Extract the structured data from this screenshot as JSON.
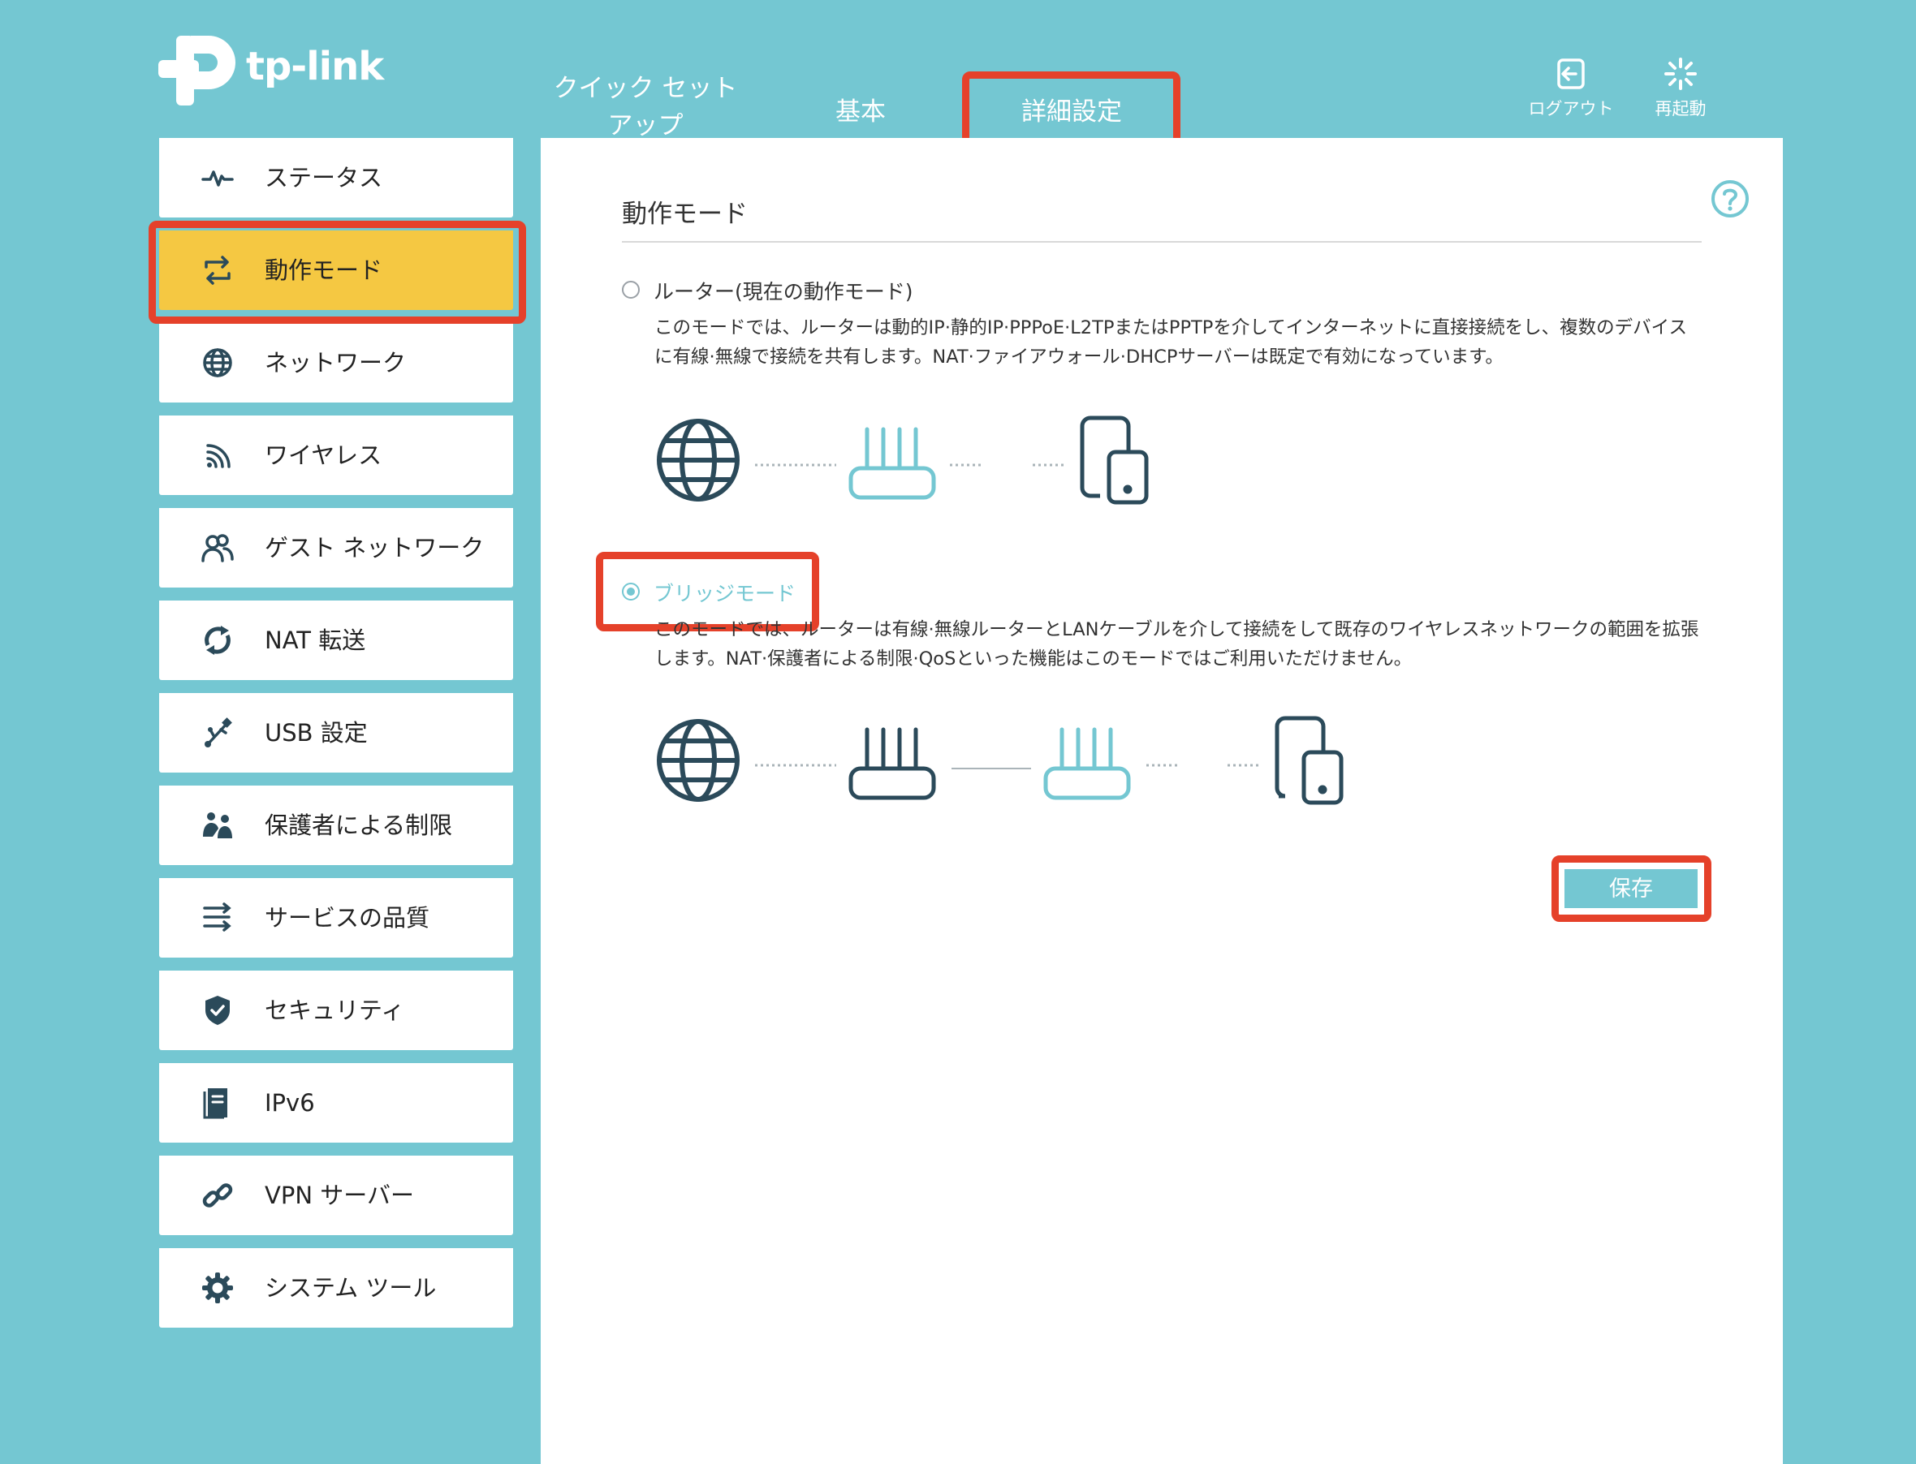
{
  "brand": {
    "name": "tp-link"
  },
  "nav": {
    "tabs": [
      {
        "label": "クイック セット アップ"
      },
      {
        "label": "基本"
      },
      {
        "label": "詳細設定",
        "active": true
      }
    ],
    "logout_label": "ログアウト",
    "reboot_label": "再起動"
  },
  "sidebar": {
    "items": [
      {
        "label": "ステータス",
        "icon": "pulse-icon"
      },
      {
        "label": "動作モード",
        "icon": "mode-switch-icon",
        "active": true
      },
      {
        "label": "ネットワーク",
        "icon": "globe-icon"
      },
      {
        "label": "ワイヤレス",
        "icon": "wifi-icon"
      },
      {
        "label": "ゲスト ネットワーク",
        "icon": "guest-users-icon"
      },
      {
        "label": "NAT 転送",
        "icon": "nat-refresh-icon"
      },
      {
        "label": "USB 設定",
        "icon": "usb-icon"
      },
      {
        "label": "保護者による制限",
        "icon": "family-icon"
      },
      {
        "label": "サービスの品質",
        "icon": "qos-lines-icon"
      },
      {
        "label": "セキュリティ",
        "icon": "shield-icon"
      },
      {
        "label": "IPv6",
        "icon": "document-icon"
      },
      {
        "label": "VPN サーバー",
        "icon": "link-icon"
      },
      {
        "label": "システム ツール",
        "icon": "gear-icon"
      }
    ]
  },
  "main": {
    "title": "動作モード",
    "options": [
      {
        "label": "ルーター(現在の動作モード)",
        "selected": false,
        "description": "このモードでは、ルーターは動的IP·静的IP·PPPoE·L2TPまたはPPTPを介してインターネットに直接接続をし、複数のデバイスに有線·無線で接続を共有します。NAT·ファイアウォール·DHCPサーバーは既定で有効になっています。"
      },
      {
        "label": "ブリッジモード",
        "selected": true,
        "description": "このモードでは、ルーターは有線·無線ルーターとLANケーブルを介して接続をして既存のワイヤレスネットワークの範囲を拡張します。NAT·保護者による制限·QoSといった機能はこのモードではご利用いただけません。"
      }
    ],
    "save_label": "保存"
  },
  "colors": {
    "background": "#74c7d2",
    "accent": "#74c7d2",
    "active_item": "#f5c842",
    "highlight": "#e5412a",
    "icon_dark": "#2b4a5a"
  }
}
